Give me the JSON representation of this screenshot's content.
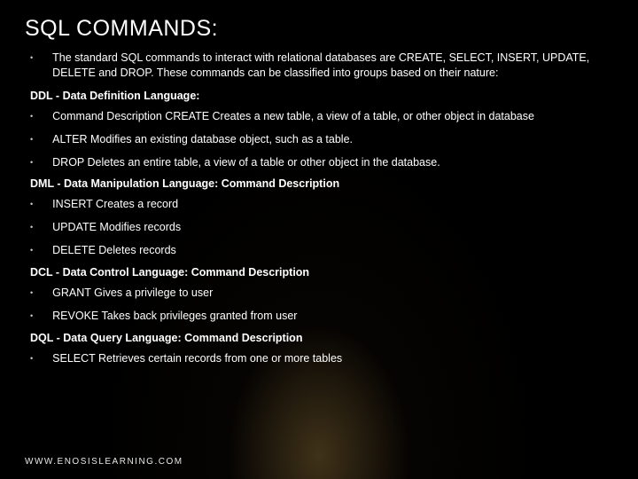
{
  "title": "SQL COMMANDS:",
  "intro": "The standard SQL commands to interact with relational databases are CREATE, SELECT, INSERT, UPDATE, DELETE and DROP. These commands can be classified into groups based on their nature:",
  "sections": [
    {
      "heading": "DDL - Data Definition Language:",
      "items": [
        "Command Description CREATE Creates a new table, a view of a table, or other object in database",
        " ALTER Modifies an existing database object, such as a table.",
        " DROP Deletes an entire table, a view of a table or other object in the database."
      ]
    },
    {
      "heading": "DML - Data Manipulation Language: Command Description",
      "items": [
        " INSERT Creates a record",
        "UPDATE Modifies records",
        "DELETE Deletes records"
      ]
    },
    {
      "heading": "DCL - Data Control Language: Command Description",
      "items": [
        "GRANT Gives a privilege to user",
        "REVOKE Takes back privileges granted from user"
      ]
    },
    {
      "heading": "DQL - Data Query Language: Command Description",
      "items": [
        "SELECT Retrieves certain records from one or more tables"
      ]
    }
  ],
  "footer": "WWW.ENOSISLEARNING.COM"
}
